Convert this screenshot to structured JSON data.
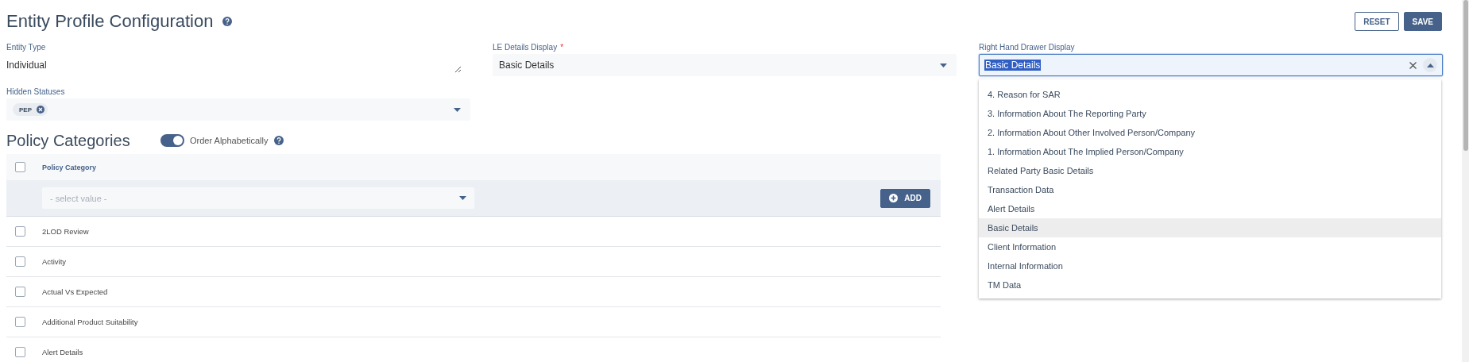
{
  "page": {
    "title": "Entity Profile Configuration"
  },
  "actions": [
    {
      "label": "RESET",
      "kind": "outline"
    },
    {
      "label": "SAVE",
      "kind": "primary"
    }
  ],
  "fields": [
    {
      "label": "Entity Type",
      "kind": "textarea",
      "value": "Individual"
    },
    {
      "label": "LE Details Display",
      "kind": "select",
      "value": "Basic Details",
      "required_mark": "*"
    },
    {
      "label": "Right Hand Drawer Display",
      "kind": "combo",
      "value": "Basic Details",
      "focused": true,
      "expanded": true,
      "options": [
        {
          "label": "4. Reason for SAR",
          "selected": false
        },
        {
          "label": "3. Information About The Reporting Party",
          "selected": false
        },
        {
          "label": "2. Information About Other Involved Person/Company",
          "selected": false
        },
        {
          "label": "1. Information About The Implied Person/Company",
          "selected": false
        },
        {
          "label": "Related Party Basic Details",
          "selected": false
        },
        {
          "label": "Transaction Data",
          "selected": false
        },
        {
          "label": "Alert Details",
          "selected": false
        },
        {
          "label": "Basic Details",
          "selected": true
        },
        {
          "label": "Client Information",
          "selected": false
        },
        {
          "label": "Internal Information",
          "selected": false
        },
        {
          "label": "TM Data",
          "selected": false
        }
      ]
    },
    {
      "label": "Hidden Statuses",
      "kind": "tags",
      "tags": [
        "PEP"
      ]
    }
  ],
  "policy_categories": {
    "title": "Policy Categories",
    "toggle": {
      "label": "Order Alphabetically",
      "on": true
    },
    "table": {
      "header": {
        "label": "Policy Category",
        "checked": false
      },
      "filter": {
        "placeholder": "- select value -",
        "button": "ADD"
      },
      "rows": [
        {
          "label": "2LOD Review",
          "checked": false
        },
        {
          "label": "Activity",
          "checked": false
        },
        {
          "label": "Actual Vs Expected",
          "checked": false
        },
        {
          "label": "Additional Product Suitability",
          "checked": false
        },
        {
          "label": "Alert Details",
          "checked": false
        }
      ]
    }
  }
}
